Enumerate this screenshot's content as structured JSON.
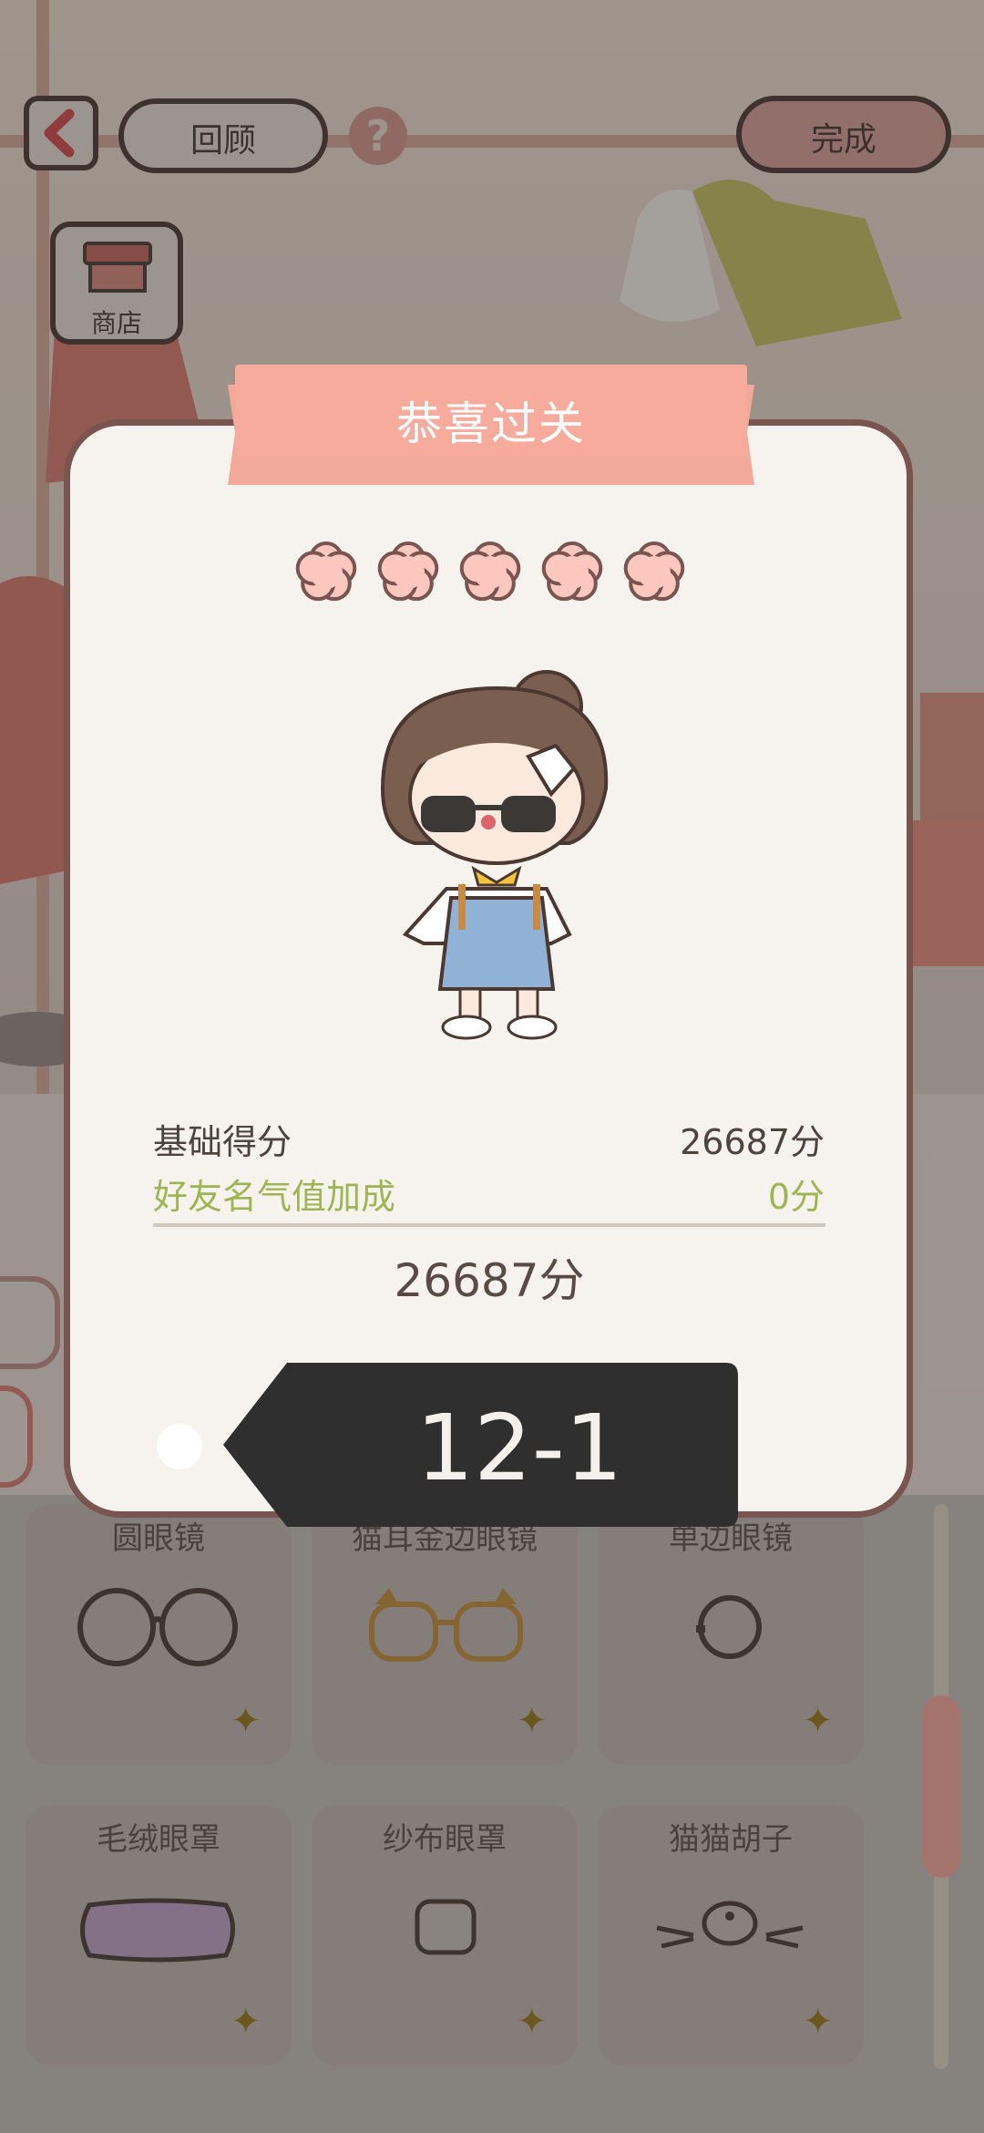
{
  "top_bar": {
    "review_label": "回顾",
    "done_label": "完成",
    "shop_label": "商店"
  },
  "dialog": {
    "title": "恭喜过关",
    "stars": 5,
    "base_score_label": "基础得分",
    "base_score_value": "26687分",
    "friend_bonus_label": "好友名气值加成",
    "friend_bonus_value": "0分",
    "total_score": "26687分",
    "level": "12-1"
  },
  "items": [
    {
      "label": "圆眼镜",
      "icon": "round-glasses-icon"
    },
    {
      "label": "猫耳金边眼镜",
      "icon": "cat-ear-glasses-icon"
    },
    {
      "label": "单边眼镜",
      "icon": "monocle-icon"
    },
    {
      "label": "毛绒眼罩",
      "icon": "plush-eye-mask-icon"
    },
    {
      "label": "纱布眼罩",
      "icon": "gauze-eye-patch-icon"
    },
    {
      "label": "猫猫胡子",
      "icon": "cat-whiskers-icon"
    }
  ],
  "colors": {
    "accent": "#f2a898",
    "bonus_text": "#9db552",
    "dark_tag": "#2f2f2f",
    "dialog_bg": "#f6f3ee"
  }
}
